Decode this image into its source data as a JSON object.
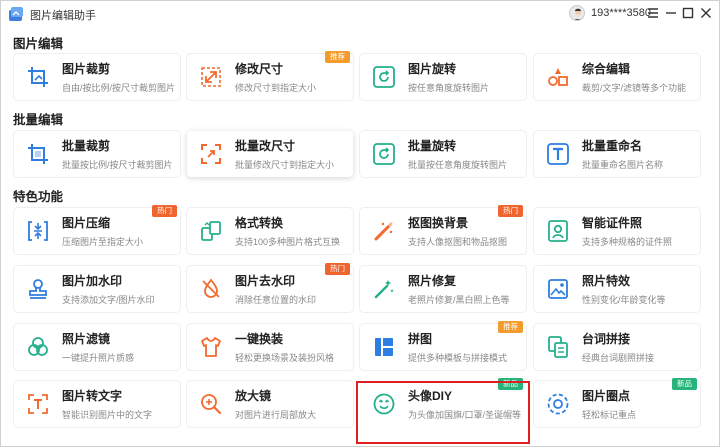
{
  "app": {
    "title": "图片编辑助手",
    "user_phone": "193****3580"
  },
  "sections": {
    "edit": "图片编辑",
    "batch": "批量编辑",
    "special": "特色功能"
  },
  "cards": {
    "crop": {
      "title": "图片裁剪",
      "desc": "自由/按比例/按尺寸裁剪图片"
    },
    "resize": {
      "title": "修改尺寸",
      "desc": "修改尺寸到指定大小",
      "badge": "推荐"
    },
    "rotate": {
      "title": "图片旋转",
      "desc": "按任意角度旋转图片"
    },
    "combo": {
      "title": "综合编辑",
      "desc": "裁剪/文字/滤镜等多个功能"
    },
    "batch_crop": {
      "title": "批量裁剪",
      "desc": "批量按比例/按尺寸裁剪图片"
    },
    "batch_resize": {
      "title": "批量改尺寸",
      "desc": "批量修改尺寸到指定大小"
    },
    "batch_rotate": {
      "title": "批量旋转",
      "desc": "批量按任意角度旋转图片"
    },
    "batch_rename": {
      "title": "批量重命名",
      "desc": "批量重命名图片名称"
    },
    "compress": {
      "title": "图片压缩",
      "desc": "压缩图片至指定大小",
      "badge": "热门"
    },
    "convert": {
      "title": "格式转换",
      "desc": "支持100多种图片格式互换"
    },
    "matting": {
      "title": "抠图换背景",
      "desc": "支持人像抠图和物品抠图",
      "badge": "热门"
    },
    "idphoto": {
      "title": "智能证件照",
      "desc": "支持多种规格的证件照"
    },
    "watermark_add": {
      "title": "图片加水印",
      "desc": "支持添加文字/图片水印"
    },
    "watermark_remove": {
      "title": "图片去水印",
      "desc": "消除任意位置的水印",
      "badge": "热门"
    },
    "repair": {
      "title": "照片修复",
      "desc": "老照片修复/黑白照上色等"
    },
    "effects": {
      "title": "照片特效",
      "desc": "性别变化/年龄变化等"
    },
    "filter": {
      "title": "照片滤镜",
      "desc": "一键提升照片质感"
    },
    "outfit": {
      "title": "一键换装",
      "desc": "轻松更换场景及装扮风格"
    },
    "collage": {
      "title": "拼图",
      "desc": "提供多种模板与拼接模式",
      "badge": "推荐"
    },
    "caption": {
      "title": "台词拼接",
      "desc": "经典台词剧照拼接"
    },
    "ocr": {
      "title": "图片转文字",
      "desc": "智能识别图片中的文字"
    },
    "magnifier": {
      "title": "放大镜",
      "desc": "对图片进行局部放大"
    },
    "avatar_diy": {
      "title": "头像DIY",
      "desc": "为头像加国旗/口罩/圣诞帽等",
      "badge": "新品"
    },
    "circle": {
      "title": "图片圈点",
      "desc": "轻松标记重点",
      "badge": "新品"
    }
  },
  "colors": {
    "accent": "#3d7fe0",
    "icon_orange": "#f26a2e",
    "icon_teal": "#24b08a",
    "icon_blue": "#2f7de1",
    "highlight": "#e02020"
  },
  "icons": {
    "app_logo": "app-logo",
    "minimize": "minimize-icon",
    "restore": "maximize-icon",
    "close": "close-icon",
    "menu": "menu-icon"
  }
}
